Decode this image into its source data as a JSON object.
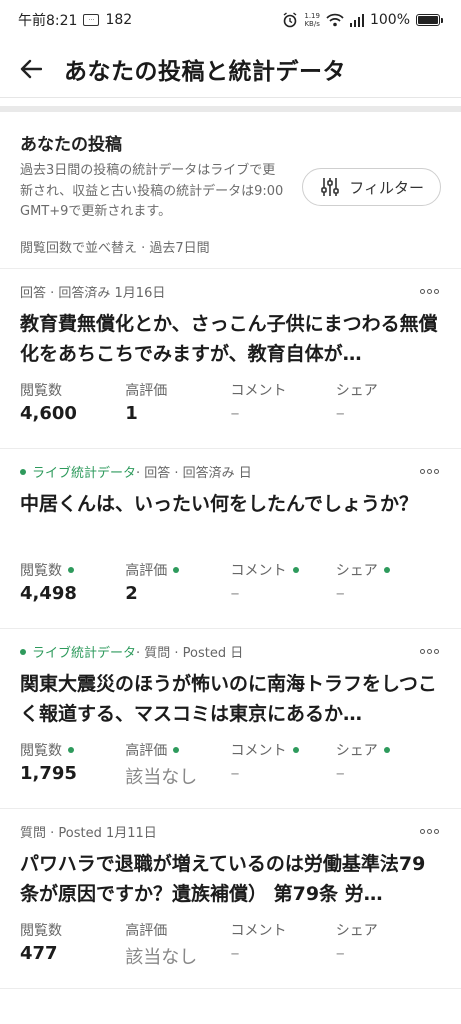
{
  "status_bar": {
    "time": "午前8:21",
    "notif_count": "182",
    "net_speed_top": "1.19",
    "net_speed_bottom": "KB/s",
    "battery": "100%"
  },
  "app_bar": {
    "title": "あなたの投稿と統計データ"
  },
  "summary": {
    "title": "あなたの投稿",
    "description": "過去3日間の投稿の統計データはライブで更新され、収益と古い投稿の統計データは9:00 GMT+9で更新されます。",
    "filter_label": "フィルター",
    "sort_label": "閲覧回数で並べ替え · 過去7日間"
  },
  "stat_labels": {
    "views": "閲覧数",
    "upvotes": "高評価",
    "comments": "コメント",
    "shares": "シェア"
  },
  "posts": [
    {
      "live": "",
      "meta": "回答 · 回答済み 1月16日",
      "title": "教育費無償化とか、さっこん子供にまつわる無償化をあちこちでみますが、教育自体が…",
      "views": "4,600",
      "upvotes": "1",
      "comments": "–",
      "shares": "–"
    },
    {
      "live": "ライブ統計データ",
      "meta": " · 回答 · 回答済み 日",
      "title": "中居くんは、いったい何をしたんでしょうか？",
      "views": "4,498",
      "upvotes": "2",
      "comments": "–",
      "shares": "–"
    },
    {
      "live": "ライブ統計データ",
      "meta": " · 質問 · Posted 日",
      "title": "関東大震災のほうが怖いのに南海トラフをしつこく報道する、マスコミは東京にあるか…",
      "views": "1,795",
      "upvotes": "該当なし",
      "comments": "–",
      "shares": "–"
    },
    {
      "live": "",
      "meta": "質問 · Posted 1月11日",
      "title": "パワハラで退職が増えているのは労働基準法79条が原因ですか？遺族補償） 第79条 労…",
      "views": "477",
      "upvotes": "該当なし",
      "comments": "–",
      "shares": "–"
    }
  ],
  "colors": {
    "live_green": "#2e9a5c",
    "divider": "#e9e9e9"
  }
}
